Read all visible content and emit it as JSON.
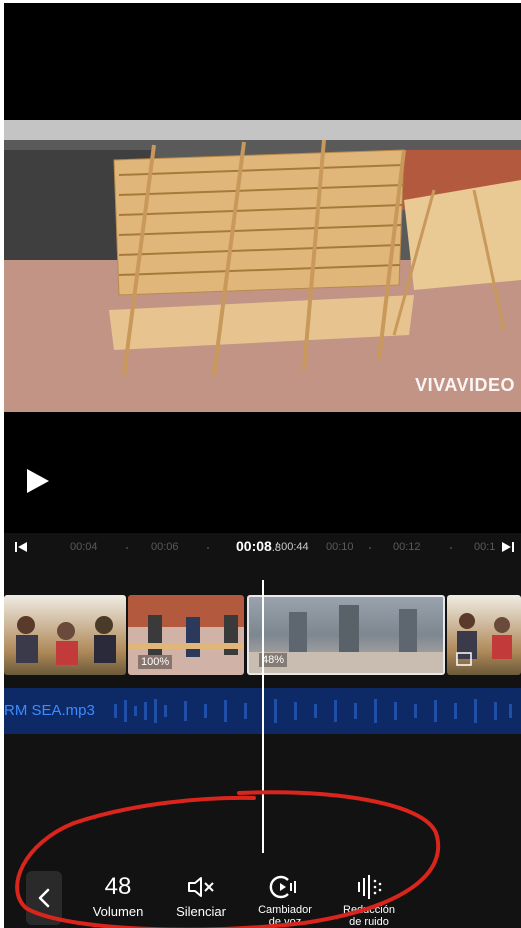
{
  "preview": {
    "watermark": "VIVAVIDEO"
  },
  "ruler": {
    "ticks": [
      "00:04",
      "00:06",
      "00:10",
      "00:12",
      "00:1"
    ],
    "current_time": "00:08",
    "current_fraction": ".3",
    "total_time": "/ 00:44"
  },
  "timeline": {
    "clip2_badge": "100%",
    "clip3_badge": "48%",
    "audio_name": "RM SEA.mp3"
  },
  "toolbar": {
    "volume_value": "48",
    "volume_label": "Volumen",
    "mute_label": "Silenciar",
    "voice_changer_label_line1": "Cambiador",
    "voice_changer_label_line2": "de voz",
    "noise_reduction_label_line1": "Reducción",
    "noise_reduction_label_line2": "de ruido"
  },
  "colors": {
    "accent_blue": "#3b8cff",
    "audio_track": "#0d2a66",
    "annotation_red": "#d9251c"
  }
}
